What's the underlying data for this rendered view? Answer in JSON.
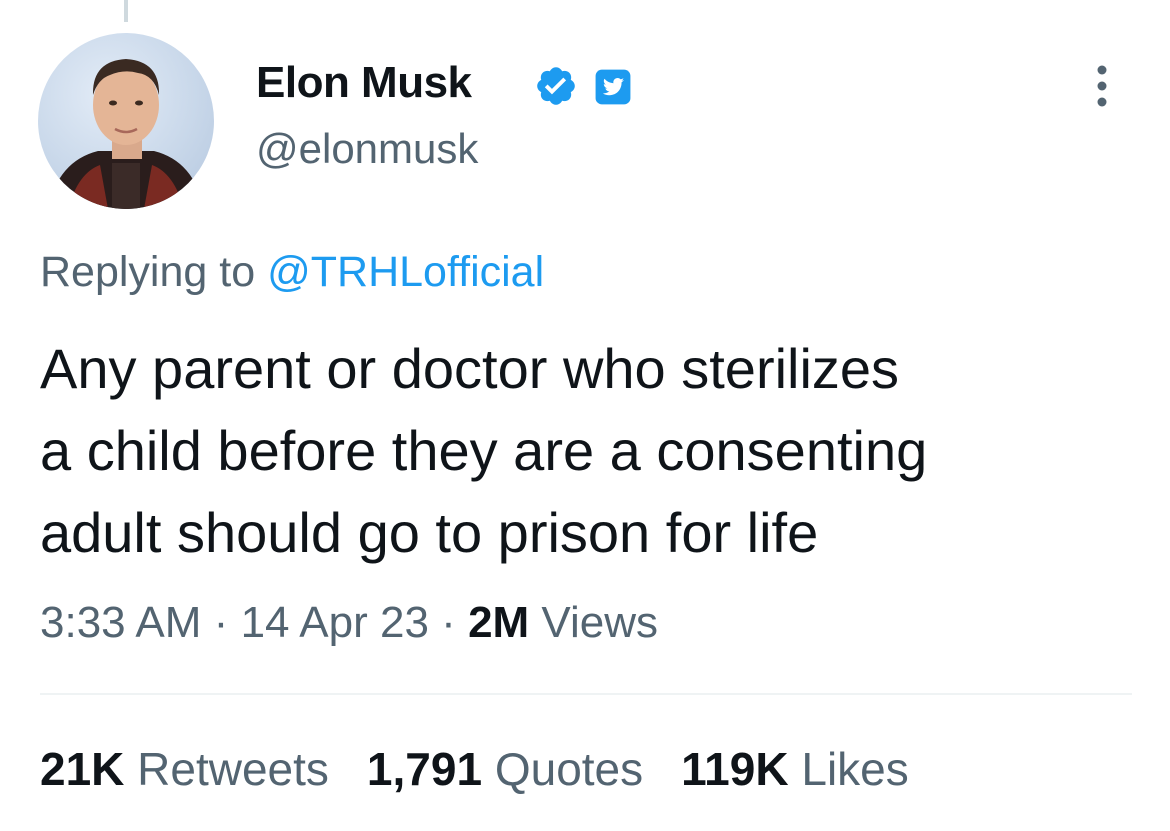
{
  "tweet": {
    "author": {
      "display_name": "Elon Musk",
      "handle": "@elonmusk",
      "verified_icon": "verified-badge-icon",
      "affiliate_icon": "twitter-bird-icon"
    },
    "reply": {
      "prefix": "Replying to",
      "mention": "@TRHLofficial"
    },
    "text_lines": [
      "Any parent or doctor who sterilizes",
      "a child before they are a consenting",
      "adult should go to prison for life"
    ],
    "meta": {
      "time": "3:33 AM",
      "separator": "·",
      "date": "14 Apr 23",
      "views_count": "2M",
      "views_label": "Views"
    },
    "stats": {
      "retweets_count": "21K",
      "retweets_label": "Retweets",
      "quotes_count": "1,791",
      "quotes_label": "Quotes",
      "likes_count": "119K",
      "likes_label": "Likes"
    }
  },
  "colors": {
    "primary_text": "#0f1419",
    "secondary_text": "#536471",
    "accent": "#1d9bf0",
    "divider": "#eff3f4"
  }
}
